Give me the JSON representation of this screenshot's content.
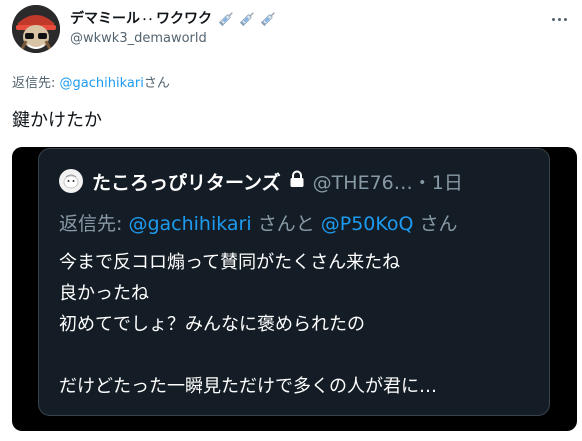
{
  "author": {
    "display_name": "デマミール",
    "name_dots": "･･",
    "name_suffix": "ワクワク",
    "emoji_icons": [
      "syringe-icon",
      "syringe-icon",
      "syringe-icon"
    ],
    "handle": "@wkwk3_demaworld"
  },
  "reply": {
    "prefix": "返信先: ",
    "mention": "@gachihikari",
    "suffix": "さん"
  },
  "tweet": {
    "text": "鍵かけたか"
  },
  "quoted": {
    "display_name": "たころっぴリターンズ",
    "handle_time": "@THE76…・1日",
    "reply_prefix": "返信先: ",
    "reply_mention_1": "@gachihikari",
    "reply_middle": " さんと ",
    "reply_mention_2": "@P50KoQ",
    "reply_suffix": " さん",
    "lines": [
      "今まで反コロ煽って賛同がたくさん来たね",
      "良かったね",
      "初めてでしょ？みんなに褒められたの",
      "",
      "だけどたった一瞬見ただけで多くの人が君に…"
    ]
  },
  "colors": {
    "link": "#1d9bf0",
    "secondary_text": "#536471",
    "embed_background": "#141d26"
  }
}
